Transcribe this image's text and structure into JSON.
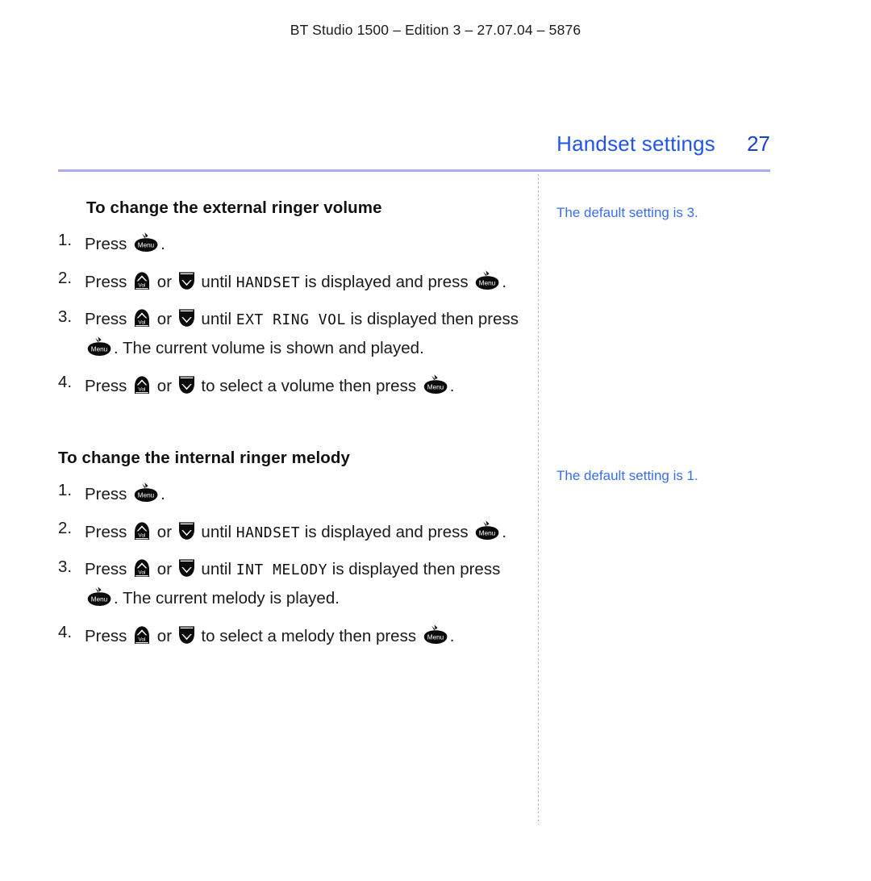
{
  "document": {
    "running_header": "BT Studio 1500 – Edition 3 – 27.07.04 – 5876",
    "page_title": "Handset settings",
    "page_number": "27"
  },
  "colors": {
    "title_blue": "#2255ee",
    "page_number_blue": "#1a3fd0",
    "rule_lavender": "#aaaaf5",
    "note_blue": "#3a6ef0",
    "divider_dotted": "#9aa8ee",
    "body_text": "#1a1a1a"
  },
  "icons": {
    "menu": {
      "name": "menu-key-icon",
      "label": "Menu"
    },
    "volume_up": {
      "name": "volume-up-key-icon",
      "label": "Vol"
    },
    "volume_down": {
      "name": "volume-down-key-icon",
      "label": ""
    }
  },
  "sections": [
    {
      "heading": "To change the external ringer volume",
      "indented": true,
      "steps": [
        {
          "number": "1.",
          "parts": [
            {
              "type": "text",
              "value": "Press "
            },
            {
              "type": "icon",
              "value": "menu"
            },
            {
              "type": "text",
              "value": "."
            }
          ]
        },
        {
          "number": "2.",
          "parts": [
            {
              "type": "text",
              "value": "Press "
            },
            {
              "type": "icon",
              "value": "up"
            },
            {
              "type": "text",
              "value": " or "
            },
            {
              "type": "icon",
              "value": "down"
            },
            {
              "type": "text",
              "value": " until "
            },
            {
              "type": "lcd",
              "value": "HANDSET"
            },
            {
              "type": "text",
              "value": " is displayed and press "
            },
            {
              "type": "icon",
              "value": "menu"
            },
            {
              "type": "text",
              "value": "."
            }
          ]
        },
        {
          "number": "3.",
          "parts": [
            {
              "type": "text",
              "value": "Press "
            },
            {
              "type": "icon",
              "value": "up"
            },
            {
              "type": "text",
              "value": " or "
            },
            {
              "type": "icon",
              "value": "down"
            },
            {
              "type": "text",
              "value": " until "
            },
            {
              "type": "lcd",
              "value": "EXT RING VOL"
            },
            {
              "type": "text",
              "value": " is displayed then press "
            },
            {
              "type": "icon",
              "value": "menu"
            },
            {
              "type": "text",
              "value": ". The current volume is shown and played."
            }
          ]
        },
        {
          "number": "4.",
          "parts": [
            {
              "type": "text",
              "value": "Press "
            },
            {
              "type": "icon",
              "value": "up"
            },
            {
              "type": "text",
              "value": " or "
            },
            {
              "type": "icon",
              "value": "down"
            },
            {
              "type": "text",
              "value": " to select a volume then press "
            },
            {
              "type": "icon",
              "value": "menu"
            },
            {
              "type": "text",
              "value": "."
            }
          ]
        }
      ],
      "note": "The default setting is 3."
    },
    {
      "heading": "To change the internal ringer melody",
      "indented": false,
      "steps": [
        {
          "number": "1.",
          "parts": [
            {
              "type": "text",
              "value": "Press "
            },
            {
              "type": "icon",
              "value": "menu"
            },
            {
              "type": "text",
              "value": "."
            }
          ]
        },
        {
          "number": "2.",
          "parts": [
            {
              "type": "text",
              "value": "Press "
            },
            {
              "type": "icon",
              "value": "up"
            },
            {
              "type": "text",
              "value": " or "
            },
            {
              "type": "icon",
              "value": "down"
            },
            {
              "type": "text",
              "value": " until "
            },
            {
              "type": "lcd",
              "value": "HANDSET"
            },
            {
              "type": "text",
              "value": " is displayed and press "
            },
            {
              "type": "icon",
              "value": "menu"
            },
            {
              "type": "text",
              "value": "."
            }
          ]
        },
        {
          "number": "3.",
          "parts": [
            {
              "type": "text",
              "value": "Press "
            },
            {
              "type": "icon",
              "value": "up"
            },
            {
              "type": "text",
              "value": " or "
            },
            {
              "type": "icon",
              "value": "down"
            },
            {
              "type": "text",
              "value": " until "
            },
            {
              "type": "lcd",
              "value": "INT MELODY"
            },
            {
              "type": "text",
              "value": " is displayed then press "
            },
            {
              "type": "icon",
              "value": "menu"
            },
            {
              "type": "text",
              "value": ". The current melody is played."
            }
          ]
        },
        {
          "number": "4.",
          "parts": [
            {
              "type": "text",
              "value": "Press "
            },
            {
              "type": "icon",
              "value": "up"
            },
            {
              "type": "text",
              "value": " or "
            },
            {
              "type": "icon",
              "value": "down"
            },
            {
              "type": "text",
              "value": " to select a melody then press "
            },
            {
              "type": "icon",
              "value": "menu"
            },
            {
              "type": "text",
              "value": "."
            }
          ]
        }
      ],
      "note": "The default setting is 1."
    }
  ]
}
